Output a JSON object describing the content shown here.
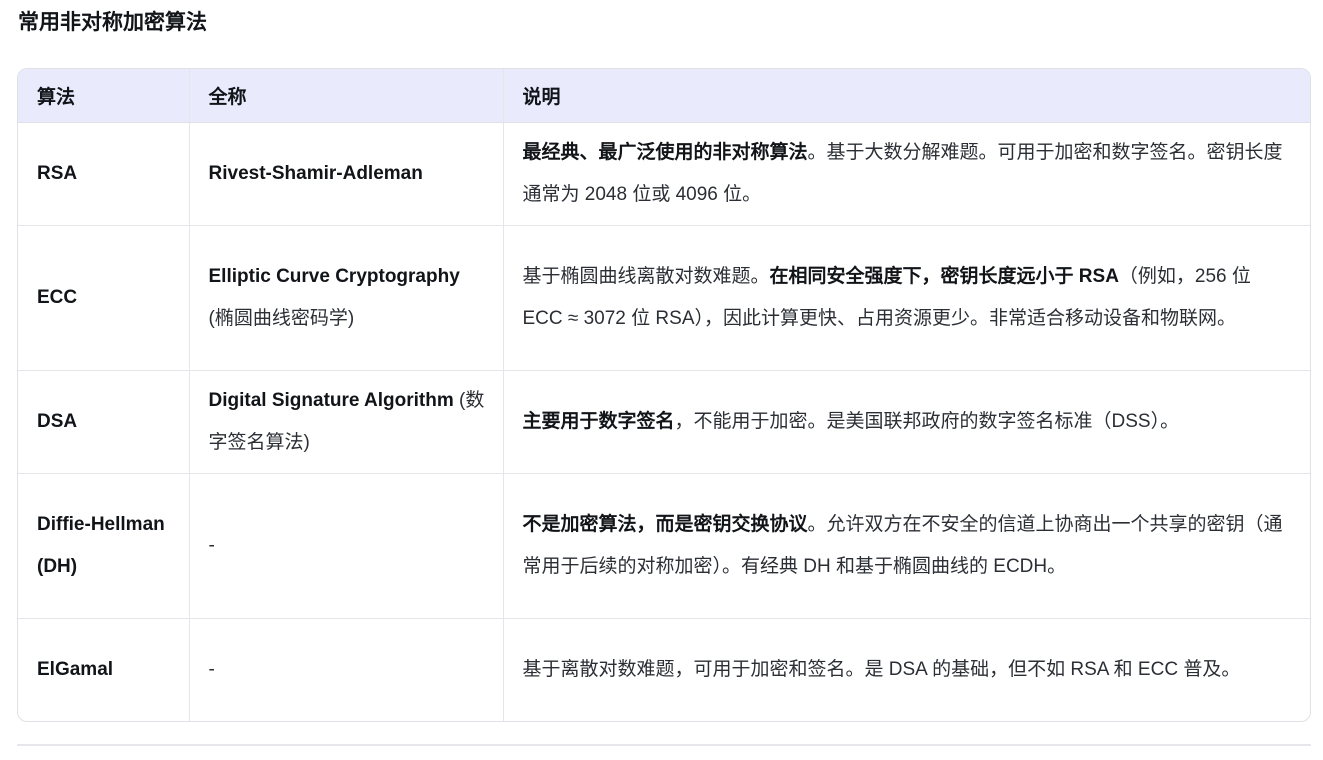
{
  "heading": "常用非对称加密算法",
  "table": {
    "headers": [
      "算法",
      "全称",
      "说明"
    ],
    "rows": [
      {
        "name": "RSA",
        "full_bold": "Rivest-Shamir-Adleman",
        "full_rest": "",
        "desc_a": "",
        "desc_bold": "最经典、最广泛使用的非对称算法",
        "desc_b": "。基于大数分解难题。可用于加密和数字签名。密钥长度通常为 2048 位或 4096 位。"
      },
      {
        "name": "ECC",
        "full_bold": "Elliptic Curve Cryptography",
        "full_rest": " (椭圆曲线密码学)",
        "desc_a": "基于椭圆曲线离散对数难题。",
        "desc_bold": "在相同安全强度下，密钥长度远小于 RSA",
        "desc_b": "（例如，256 位 ECC ≈ 3072 位 RSA），因此计算更快、占用资源更少。非常适合移动设备和物联网。"
      },
      {
        "name": "DSA",
        "full_bold": "Digital Signature Algorithm",
        "full_rest": " (数字签名算法)",
        "desc_a": "",
        "desc_bold": "主要用于数字签名",
        "desc_b": "，不能用于加密。是美国联邦政府的数字签名标准（DSS）。"
      },
      {
        "name": "Diffie-Hellman (DH)",
        "full_bold": "",
        "full_rest": "-",
        "desc_a": "",
        "desc_bold": "不是加密算法，而是密钥交换协议",
        "desc_b": "。允许双方在不安全的信道上协商出一个共享的密钥（通常用于后续的对称加密）。有经典 DH 和基于椭圆曲线的 ECDH。"
      },
      {
        "name": "ElGamal",
        "full_bold": "",
        "full_rest": "-",
        "desc_a": "基于离散对数难题，可用于加密和签名。是 DSA 的基础，但不如 RSA 和 ECC 普及。",
        "desc_bold": "",
        "desc_b": ""
      }
    ]
  },
  "colors": {
    "header_bg": "#e9eafb",
    "border": "#dfe1e6",
    "text": "#1f2328"
  }
}
